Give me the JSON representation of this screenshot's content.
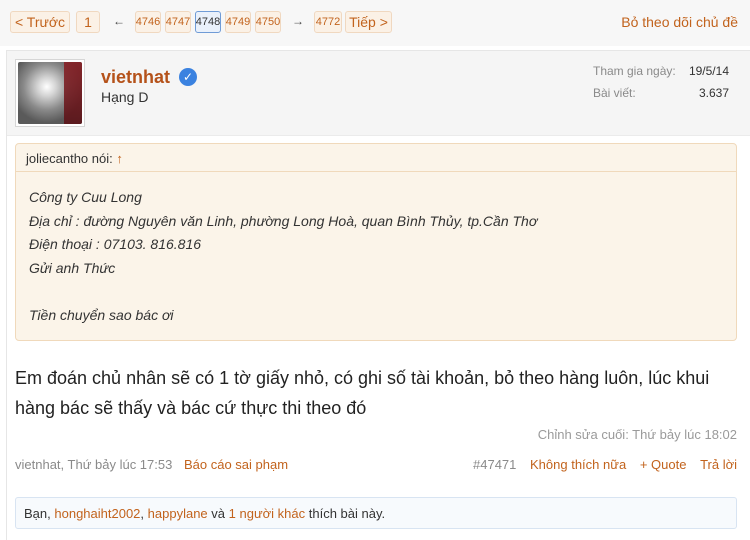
{
  "pagination": {
    "prev_label": "< Trước",
    "first_page": "1",
    "left_arrow": "←",
    "pages": [
      "4746",
      "4747",
      "4748",
      "4749",
      "4750"
    ],
    "current_page": "4748",
    "right_arrow": "→",
    "last_page": "4772",
    "next_label": "Tiếp >"
  },
  "thread_action": {
    "unfollow_label": "Bỏ theo dõi chủ đề"
  },
  "post": {
    "author": {
      "name": "vietnhat",
      "rank": "Hạng D",
      "joined_label": "Tham gia ngày:",
      "joined_value": "19/5/14",
      "posts_label": "Bài viết:",
      "posts_value": "3.637"
    },
    "quote": {
      "header": "joliecantho nói:",
      "up_arrow": "↑",
      "lines": [
        "Công ty Cuu Long",
        "Địa chỉ : đường Nguyên văn Linh, phường Long Hoà, quan Bình Thủy, tp.Cần Thơ",
        "Điện thoại : 07103. 816.816",
        "Gửi anh Thức",
        "",
        "Tiền chuyển sao bác ơi"
      ]
    },
    "message_line1": "Em đoán chủ nhân sẽ có 1 tờ giấy nhỏ, có ghi số tài khoản, bỏ theo hàng luôn, lúc khui",
    "message_line2": "hàng bác sẽ thấy và bác cứ thực thi theo đó",
    "edited": "Chỉnh sửa cuối: Thứ bảy lúc 18:02",
    "byline": "vietnhat, Thứ bảy lúc 17:53",
    "report_label": "Báo cáo sai phạm",
    "post_number": "#47471",
    "unlike_label": "Không thích nữa",
    "quote_label": "+ Quote",
    "reply_label": "Trả lời",
    "likes": {
      "prefix": "Bạn,",
      "user1": "honghaiht2002",
      "comma": ",",
      "user2": "happylane",
      "and": "và",
      "others": "1 người khác",
      "suffix": "thích bài này."
    }
  },
  "colors": {
    "link": "#c2631d",
    "username": "#b5521a",
    "verified": "#3b82e0"
  },
  "icons": {
    "verified": "check-badge-icon",
    "up_arrow": "arrow-up-icon"
  }
}
